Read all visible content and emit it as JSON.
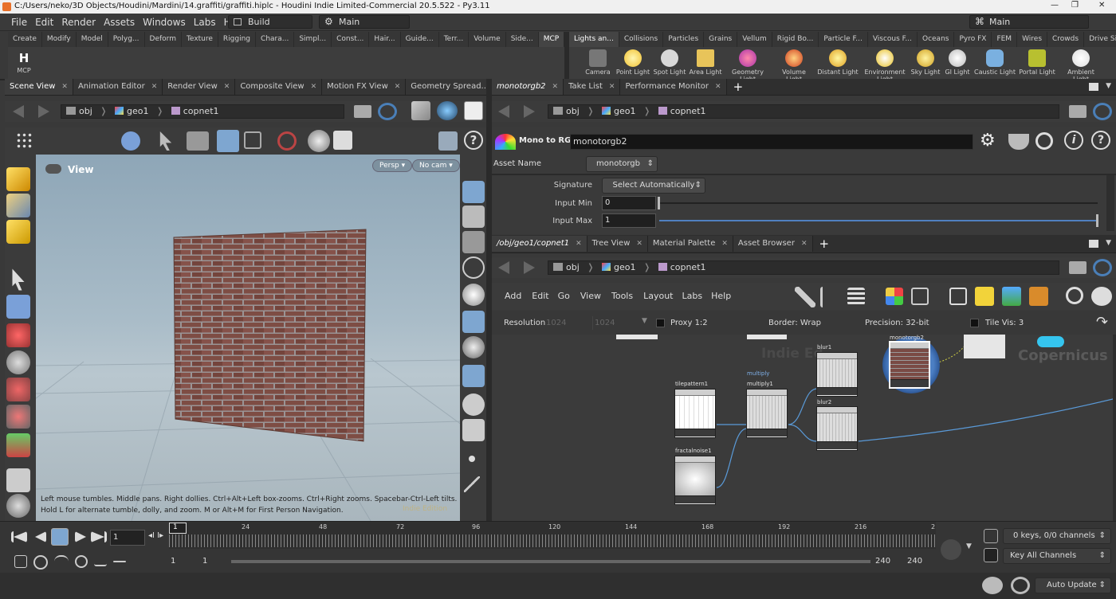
{
  "window": {
    "title": "C:/Users/neko/3D Objects/Houdini/Mardini/14.graffiti/graffiti.hiplc - Houdini Indie Limited-Commercial 20.5.522 - Py3.11",
    "min": "—",
    "max": "❐",
    "close": "✕"
  },
  "menu": [
    "File",
    "Edit",
    "Render",
    "Assets",
    "Windows",
    "Labs",
    "Help"
  ],
  "desktops": {
    "build": "Build",
    "main": "Main",
    "right": "Main"
  },
  "shelf_tabs_left": [
    "Create",
    "Modify",
    "Model",
    "Polyg...",
    "Deform",
    "Texture",
    "Rigging",
    "Chara...",
    "Simpl...",
    "Const...",
    "Hair...",
    "Guide...",
    "Terr...",
    "Volume",
    "Side...",
    "MCP"
  ],
  "shelf_tabs_right": [
    "Lights an...",
    "Collisions",
    "Particles",
    "Grains",
    "Vellum",
    "Rigid Bo...",
    "Particle F...",
    "Viscous F...",
    "Oceans",
    "Pyro FX",
    "FEM",
    "Wires",
    "Crowds",
    "Drive Si..."
  ],
  "mcp_tool": {
    "icon": "H",
    "label": "MCP"
  },
  "light_tools": [
    "Camera",
    "Point Light",
    "Spot Light",
    "Area Light",
    "Geometry Light",
    "Volume Light",
    "Distant Light",
    "Environment Light",
    "Sky Light",
    "GI Light",
    "Caustic Light",
    "Portal Light",
    "Ambient Light"
  ],
  "left_tabs": [
    "Scene View",
    "Animation Editor",
    "Render View",
    "Composite View",
    "Motion FX View",
    "Geometry Spread..."
  ],
  "path": {
    "obj": "obj",
    "geo": "geo1",
    "net": "copnet1"
  },
  "viewport": {
    "title": "View",
    "persp": "Persp",
    "cam": "No cam",
    "hint1": "Left mouse tumbles. Middle pans. Right dollies. Ctrl+Alt+Left box-zooms. Ctrl+Right zooms. Spacebar-Ctrl-Left tilts.",
    "hint2": "Hold L for alternate tumble, dolly, and zoom. M or Alt+M for First Person Navigation.",
    "watermark": "Indie Edition"
  },
  "parm_tabs": [
    "monotorgb2",
    "Take List",
    "Performance Monitor"
  ],
  "parms": {
    "type": "Mono to RGB",
    "name": "monotorgb2",
    "asset_label": "Asset Name",
    "asset": "monotorgb",
    "sig_label": "Signature",
    "sig": "Select Automatically",
    "min_label": "Input Min",
    "min": "0",
    "max_label": "Input Max",
    "max": "1"
  },
  "net_tabs": [
    "/obj/geo1/copnet1",
    "Tree View",
    "Material Palette",
    "Asset Browser"
  ],
  "net_menu": [
    "Add",
    "Edit",
    "Go",
    "View",
    "Tools",
    "Layout",
    "Labs",
    "Help"
  ],
  "net_options": {
    "res_label": "Resolution",
    "res_w": "1024",
    "res_h": "1024",
    "proxy": "Proxy 1:2",
    "border": "Border: Wrap",
    "precision": "Precision: 32-bit",
    "tilevis": "Tile Vis: 3"
  },
  "net_watermarks": {
    "indie": "Indie Ed",
    "copernicus": "Copernicus"
  },
  "nodes": [
    {
      "name": "tilepattern1",
      "key": "tp"
    },
    {
      "name": "fractalnoise1",
      "key": "fn"
    },
    {
      "name": "multiply1",
      "key": "mu",
      "extra": "multiply"
    },
    {
      "name": "blur1",
      "key": "b1"
    },
    {
      "name": "blur2",
      "key": "b2"
    },
    {
      "name": "monotorgb2",
      "key": "mo"
    }
  ],
  "timeline": {
    "frame": "1",
    "ticks": [
      "24",
      "48",
      "72",
      "96",
      "120",
      "144",
      "168",
      "192",
      "216",
      "2"
    ],
    "start": "1",
    "start2": "1",
    "end": "240",
    "end2": "240",
    "cur_marker": "1",
    "keys": "0 keys, 0/0 channels",
    "keyall": "Key All Channels"
  },
  "status": {
    "update": "Auto Update"
  }
}
